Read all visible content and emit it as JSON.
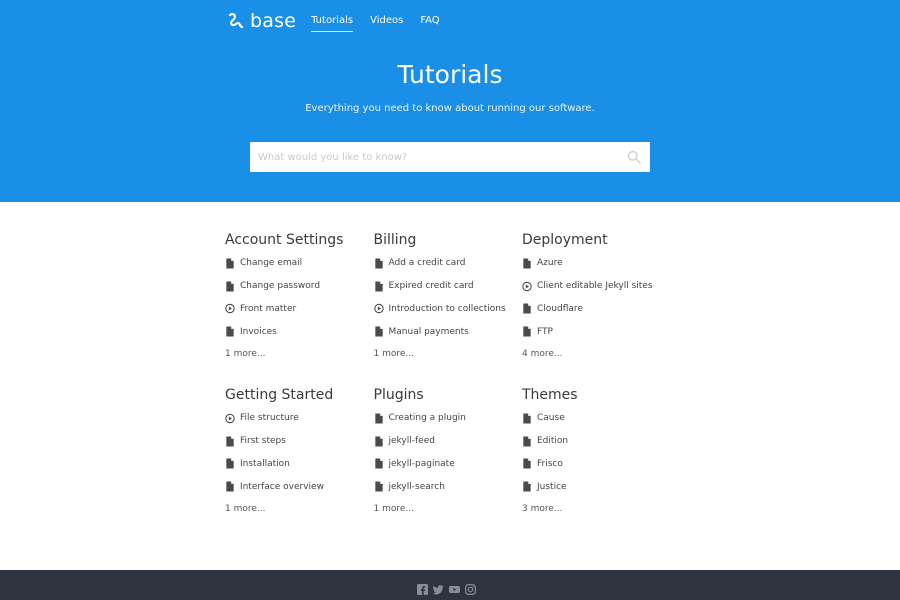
{
  "header": {
    "logo_text": "base",
    "nav": [
      "Tutorials",
      "Videos",
      "FAQ"
    ],
    "active_nav": "Tutorials"
  },
  "hero": {
    "title": "Tutorials",
    "subtitle": "Everything you need to know about running our software.",
    "search_placeholder": "What would you like to know?"
  },
  "sections": [
    {
      "title": "Account Settings",
      "items": [
        {
          "label": "Change email",
          "icon": "document-icon"
        },
        {
          "label": "Change password",
          "icon": "document-icon"
        },
        {
          "label": "Front matter",
          "icon": "play-circle-icon"
        },
        {
          "label": "Invoices",
          "icon": "document-icon"
        }
      ],
      "more": "1 more..."
    },
    {
      "title": "Billing",
      "items": [
        {
          "label": "Add a credit card",
          "icon": "document-icon"
        },
        {
          "label": "Expired credit card",
          "icon": "document-icon"
        },
        {
          "label": "Introduction to collections",
          "icon": "play-circle-icon"
        },
        {
          "label": "Manual payments",
          "icon": "document-icon"
        }
      ],
      "more": "1 more..."
    },
    {
      "title": "Deployment",
      "items": [
        {
          "label": "Azure",
          "icon": "document-icon"
        },
        {
          "label": "Client editable Jekyll sites",
          "icon": "play-circle-icon"
        },
        {
          "label": "Cloudflare",
          "icon": "document-icon"
        },
        {
          "label": "FTP",
          "icon": "document-icon"
        }
      ],
      "more": "4 more..."
    },
    {
      "title": "Getting Started",
      "items": [
        {
          "label": "File structure",
          "icon": "play-circle-icon"
        },
        {
          "label": "First steps",
          "icon": "document-icon"
        },
        {
          "label": "Installation",
          "icon": "document-icon"
        },
        {
          "label": "Interface overview",
          "icon": "document-icon"
        }
      ],
      "more": "1 more..."
    },
    {
      "title": "Plugins",
      "items": [
        {
          "label": "Creating a plugin",
          "icon": "document-icon"
        },
        {
          "label": "jekyll-feed",
          "icon": "document-icon"
        },
        {
          "label": "jekyll-paginate",
          "icon": "document-icon"
        },
        {
          "label": "jekyll-search",
          "icon": "document-icon"
        }
      ],
      "more": "1 more..."
    },
    {
      "title": "Themes",
      "items": [
        {
          "label": "Cause",
          "icon": "document-icon"
        },
        {
          "label": "Edition",
          "icon": "document-icon"
        },
        {
          "label": "Frisco",
          "icon": "document-icon"
        },
        {
          "label": "Justice",
          "icon": "document-icon"
        }
      ],
      "more": "3 more..."
    }
  ],
  "footer": {
    "social": [
      "facebook-icon",
      "twitter-icon",
      "youtube-icon",
      "instagram-icon"
    ]
  },
  "colors": {
    "hero_bg": "#1a8fe8",
    "footer_bg": "#2f3340",
    "text": "#3a3a3a"
  }
}
